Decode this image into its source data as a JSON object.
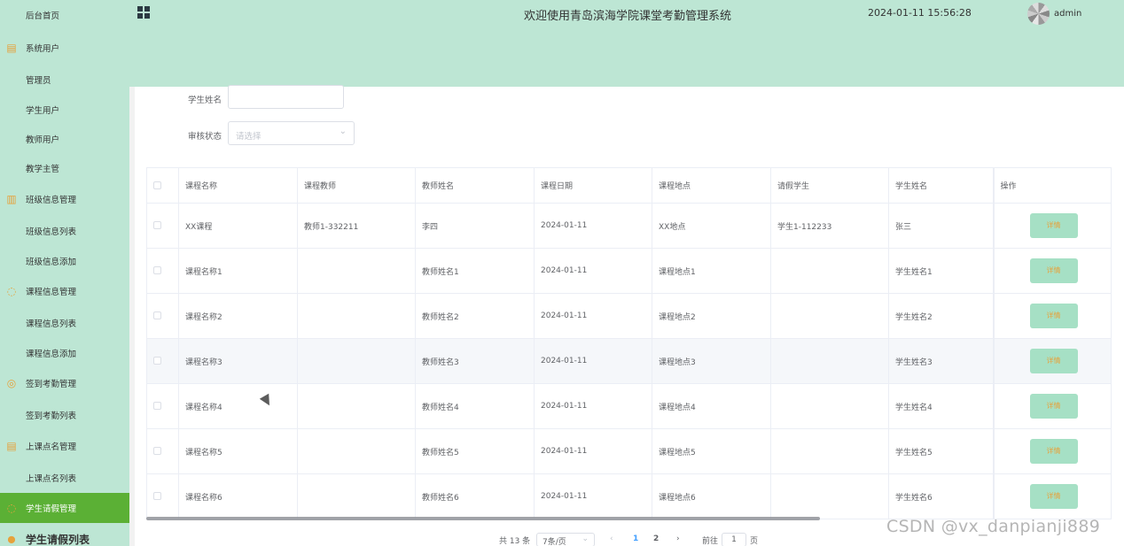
{
  "sidebar": {
    "items": [
      {
        "label": "后台首页",
        "type": "sub"
      },
      {
        "label": "系统用户",
        "type": "group",
        "icon": "document-icon"
      },
      {
        "label": "管理员",
        "type": "sub"
      },
      {
        "label": "学生用户",
        "type": "sub"
      },
      {
        "label": "教师用户",
        "type": "sub"
      },
      {
        "label": "教学主管",
        "type": "sub"
      },
      {
        "label": "班级信息管理",
        "type": "group",
        "icon": "bar-chart-icon"
      },
      {
        "label": "班级信息列表",
        "type": "sub"
      },
      {
        "label": "班级信息添加",
        "type": "sub"
      },
      {
        "label": "课程信息管理",
        "type": "group",
        "icon": "chat-icon"
      },
      {
        "label": "课程信息列表",
        "type": "sub"
      },
      {
        "label": "课程信息添加",
        "type": "sub"
      },
      {
        "label": "签到考勤管理",
        "type": "group",
        "icon": "check-circle-icon"
      },
      {
        "label": "签到考勤列表",
        "type": "sub"
      },
      {
        "label": "上课点名管理",
        "type": "group",
        "icon": "document-icon"
      },
      {
        "label": "上课点名列表",
        "type": "sub"
      },
      {
        "label": "学生请假管理",
        "type": "group",
        "icon": "chat-icon",
        "active": true
      },
      {
        "label": "学生请假列表",
        "type": "group",
        "icon": "location-icon"
      }
    ]
  },
  "header": {
    "title": "欢迎使用青岛滨海学院课堂考勤管理系统",
    "datetime": "2024-01-11 15:56:28",
    "username": "admin"
  },
  "filters": {
    "student_name_label": "学生姓名",
    "student_name_value": "",
    "status_label": "审核状态",
    "status_placeholder": "请选择"
  },
  "table": {
    "columns": [
      "课程名称",
      "课程教师",
      "教师姓名",
      "课程日期",
      "课程地点",
      "请假学生",
      "学生姓名",
      "操作"
    ],
    "detail_label": "详情",
    "rows": [
      [
        "XX课程",
        "教师1-332211",
        "李四",
        "2024-01-11",
        "XX地点",
        "学生1-112233",
        "张三"
      ],
      [
        "课程名称1",
        "",
        "教师姓名1",
        "2024-01-11",
        "课程地点1",
        "",
        "学生姓名1"
      ],
      [
        "课程名称2",
        "",
        "教师姓名2",
        "2024-01-11",
        "课程地点2",
        "",
        "学生姓名2"
      ],
      [
        "课程名称3",
        "",
        "教师姓名3",
        "2024-01-11",
        "课程地点3",
        "",
        "学生姓名3"
      ],
      [
        "课程名称4",
        "",
        "教师姓名4",
        "2024-01-11",
        "课程地点4",
        "",
        "学生姓名4"
      ],
      [
        "课程名称5",
        "",
        "教师姓名5",
        "2024-01-11",
        "课程地点5",
        "",
        "学生姓名5"
      ],
      [
        "课程名称6",
        "",
        "教师姓名6",
        "2024-01-11",
        "课程地点6",
        "",
        "学生姓名6"
      ]
    ]
  },
  "pagination": {
    "total": "共 13 条",
    "page_size": "7条/页",
    "pages": [
      "1",
      "2"
    ],
    "current": "1",
    "goto_prefix": "前往",
    "goto_value": "1",
    "goto_suffix": "页"
  },
  "watermark": "CSDN @vx_danpianji889",
  "colors": {
    "sidebar_bg": "#bde6d4",
    "active_menu": "#5bb035",
    "detail_btn": "#a6e0c5",
    "detail_text": "#e6a23c",
    "accent": "#409eff"
  }
}
